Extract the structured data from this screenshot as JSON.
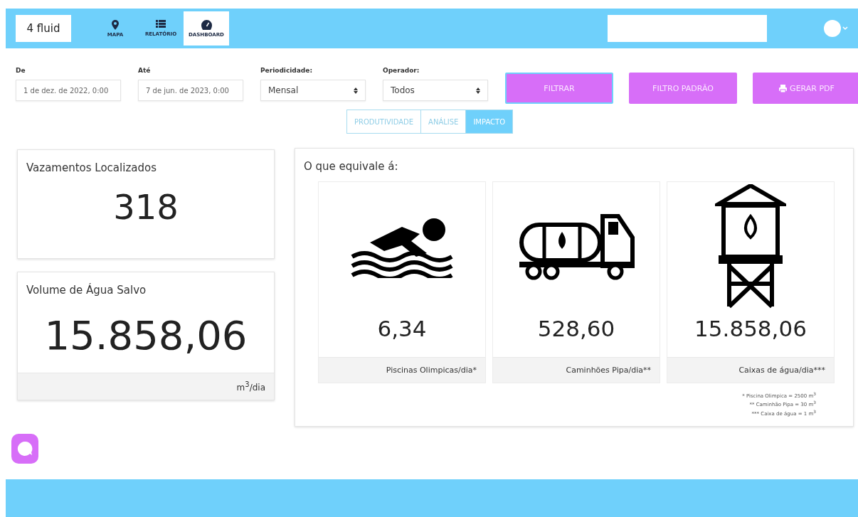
{
  "header": {
    "logo": "4 fluid",
    "nav": [
      {
        "label": "MAPA",
        "kind": "pin",
        "selected": false
      },
      {
        "label": "RELATÓRIO",
        "kind": "list",
        "selected": false
      },
      {
        "label": "DASHBOARD",
        "kind": "gauge",
        "selected": true
      }
    ]
  },
  "filters": [
    {
      "label": "De",
      "kind": "input",
      "value": "1 de dez. de 2022, 0:00"
    },
    {
      "label": "Até",
      "kind": "input",
      "value": "7 de jun. de 2023, 0:00"
    },
    {
      "label": "Periodicidade:",
      "kind": "select",
      "value": "Mensal"
    },
    {
      "label": "Operador:",
      "kind": "select",
      "value": "Todos"
    }
  ],
  "actions": [
    {
      "label": "FILTRAR",
      "focused": true,
      "kind": "plain"
    },
    {
      "label": "FILTRO PADRÃO",
      "focused": false,
      "kind": "plain"
    },
    {
      "label": "GERAR PDF",
      "focused": false,
      "kind": "print"
    }
  ],
  "tabs": [
    {
      "label": "PRODUTIVIDADE",
      "selected": false
    },
    {
      "label": "ANÁLISE",
      "selected": false
    },
    {
      "label": "IMPACTO",
      "selected": true
    }
  ],
  "stats": [
    {
      "title": "Vazamentos Localizados",
      "value": "318"
    },
    {
      "title": "Volume de Água Salvo",
      "value": "15.858,06",
      "unit": "m$^{3}$/dia"
    }
  ],
  "equivalents": {
    "title": "O que equivale á:",
    "items": [
      {
        "kind": "swimmer",
        "value": "6,34",
        "caption": "Piscinas Olimpicas/dia*"
      },
      {
        "kind": "truck",
        "value": "528,60",
        "caption": "Caminhões Pipa/dia**"
      },
      {
        "kind": "tower",
        "value": "15.858,06",
        "caption": "Caixas de água/dia***"
      }
    ],
    "notes": [
      "* Piscina Olimpica = 2500 m$^{3}$",
      "** Caminhão Pipa = 30 m$^{3}$",
      "*** Caixa de água = 1 m$^{3}$"
    ]
  }
}
